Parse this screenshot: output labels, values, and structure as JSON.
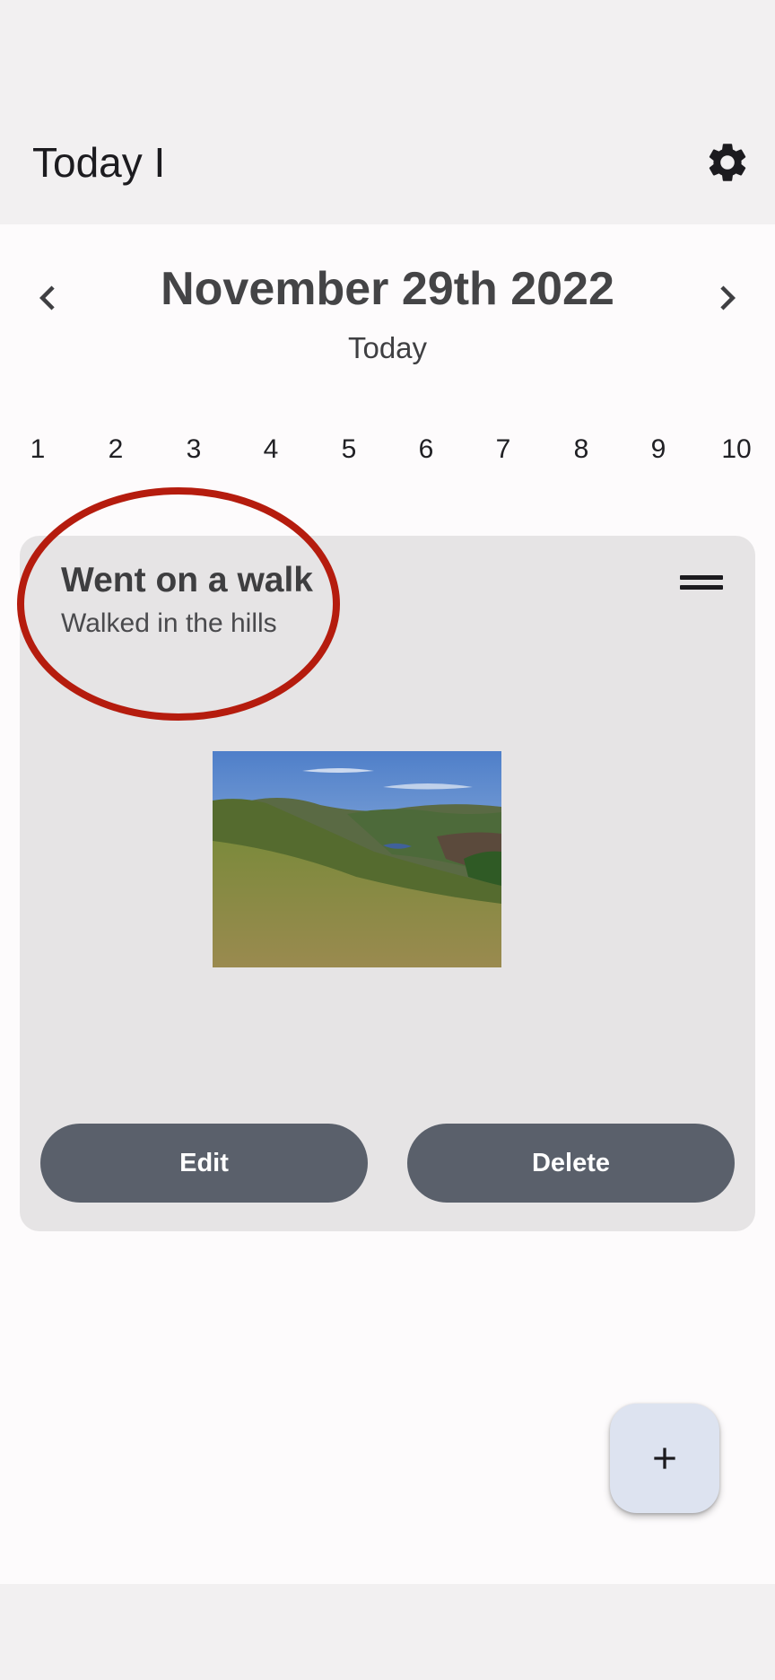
{
  "app_bar": {
    "title": "Today I",
    "settings_icon": "gear-icon"
  },
  "date_header": {
    "prev_icon": "chevron-left-icon",
    "next_icon": "chevron-right-icon",
    "date": "November 29th 2022",
    "relative": "Today"
  },
  "day_strip": {
    "days": [
      "1",
      "2",
      "3",
      "4",
      "5",
      "6",
      "7",
      "8",
      "9",
      "10"
    ]
  },
  "entry": {
    "title": "Went on a walk",
    "description": "Walked in the hills",
    "drag_icon": "drag-handle-icon",
    "image": "hills-landscape-photo",
    "edit_label": "Edit",
    "delete_label": "Delete"
  },
  "fab": {
    "icon": "plus-icon"
  },
  "colors": {
    "highlight_ring": "#b51c0e",
    "button_bg": "#5a606b",
    "card_bg": "#e6e4e5",
    "fab_bg": "#dde3f0"
  }
}
